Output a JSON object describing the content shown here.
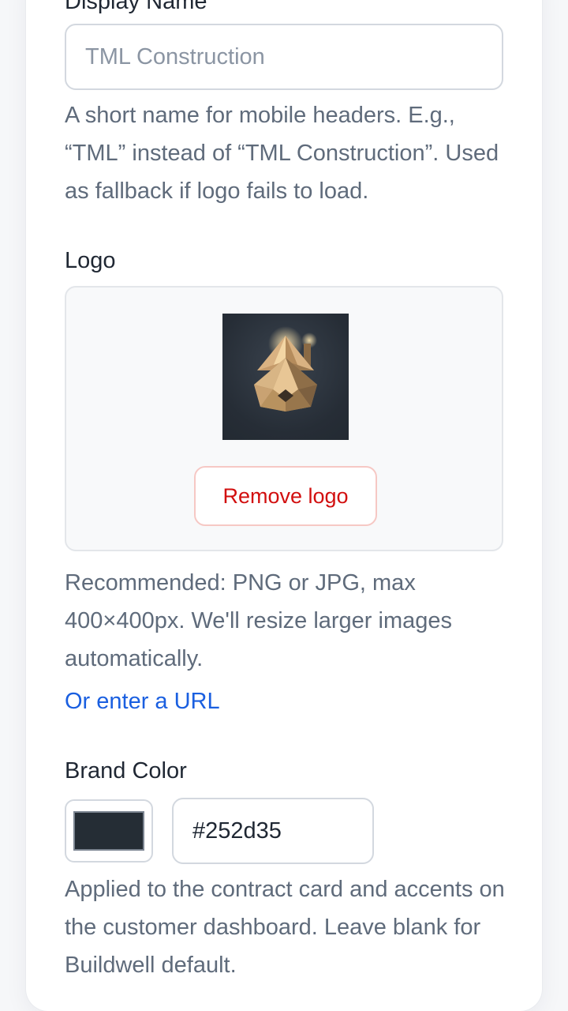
{
  "display_name": {
    "label": "Display Name",
    "value": "",
    "placeholder": "TML Construction",
    "help": "A short name for mobile headers. E.g., “TML” instead of “TML Construction”. Used as fallback if logo fails to load."
  },
  "logo": {
    "label": "Logo",
    "image_icon": "house-logo-icon",
    "remove_label": "Remove logo",
    "help": "Recommended: PNG or JPG, max 400×400px. We'll resize larger images automatically.",
    "url_link": "Or enter a URL"
  },
  "brand_color": {
    "label": "Brand Color",
    "value": "#252d35",
    "swatch_color": "#252d35",
    "help": "Applied to the contract card and accents on the customer dashboard. Leave blank for Buildwell default."
  },
  "colors": {
    "link": "#1a5fe0",
    "danger": "#d20f0f",
    "muted_text": "#5f6b7b"
  }
}
